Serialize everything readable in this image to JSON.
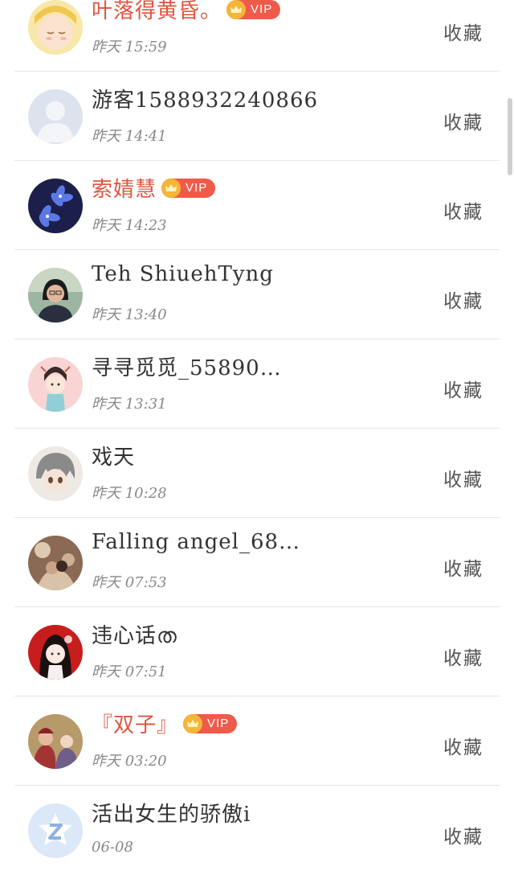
{
  "items": [
    {
      "name": "叶落得黄昏。",
      "vip": true,
      "time": "昨天 15:59",
      "action": "收藏",
      "avatar": "anime-girl-yellow-avatar"
    },
    {
      "name": "游客1588932240866",
      "vip": false,
      "time": "昨天 14:41",
      "action": "收藏",
      "avatar": "default-user-avatar"
    },
    {
      "name": "索婧慧",
      "vip": true,
      "time": "昨天 14:23",
      "action": "收藏",
      "avatar": "blue-flower-avatar"
    },
    {
      "name": "Teh ShiuehTyng",
      "vip": false,
      "time": "昨天 13:40",
      "action": "收藏",
      "avatar": "woman-photo-avatar"
    },
    {
      "name": "寻寻觅觅_55890…",
      "vip": false,
      "time": "昨天 13:31",
      "action": "收藏",
      "avatar": "cartoon-girl-pink-avatar"
    },
    {
      "name": "戏天",
      "vip": false,
      "time": "昨天 10:28",
      "action": "收藏",
      "avatar": "anime-boy-gray-avatar"
    },
    {
      "name": "Falling angel_68…",
      "vip": false,
      "time": "昨天 07:53",
      "action": "收藏",
      "avatar": "couple-photo-avatar"
    },
    {
      "name": "违心话ത",
      "vip": false,
      "time": "昨天 07:51",
      "action": "收藏",
      "avatar": "anime-girl-red-avatar"
    },
    {
      "name": "『双子』",
      "vip": true,
      "time": "昨天 03:20",
      "action": "收藏",
      "avatar": "costume-figures-avatar"
    },
    {
      "name": "活出女生的骄傲i",
      "vip": false,
      "time": "06-08",
      "action": "收藏",
      "avatar": "z-logo-avatar"
    }
  ],
  "vip_label": "VIP",
  "colors": {
    "vip_name": "#e0543f",
    "vip_badge": "#ef5b4a",
    "crown": "#f4b638",
    "text": "#333333",
    "muted": "#888888"
  }
}
